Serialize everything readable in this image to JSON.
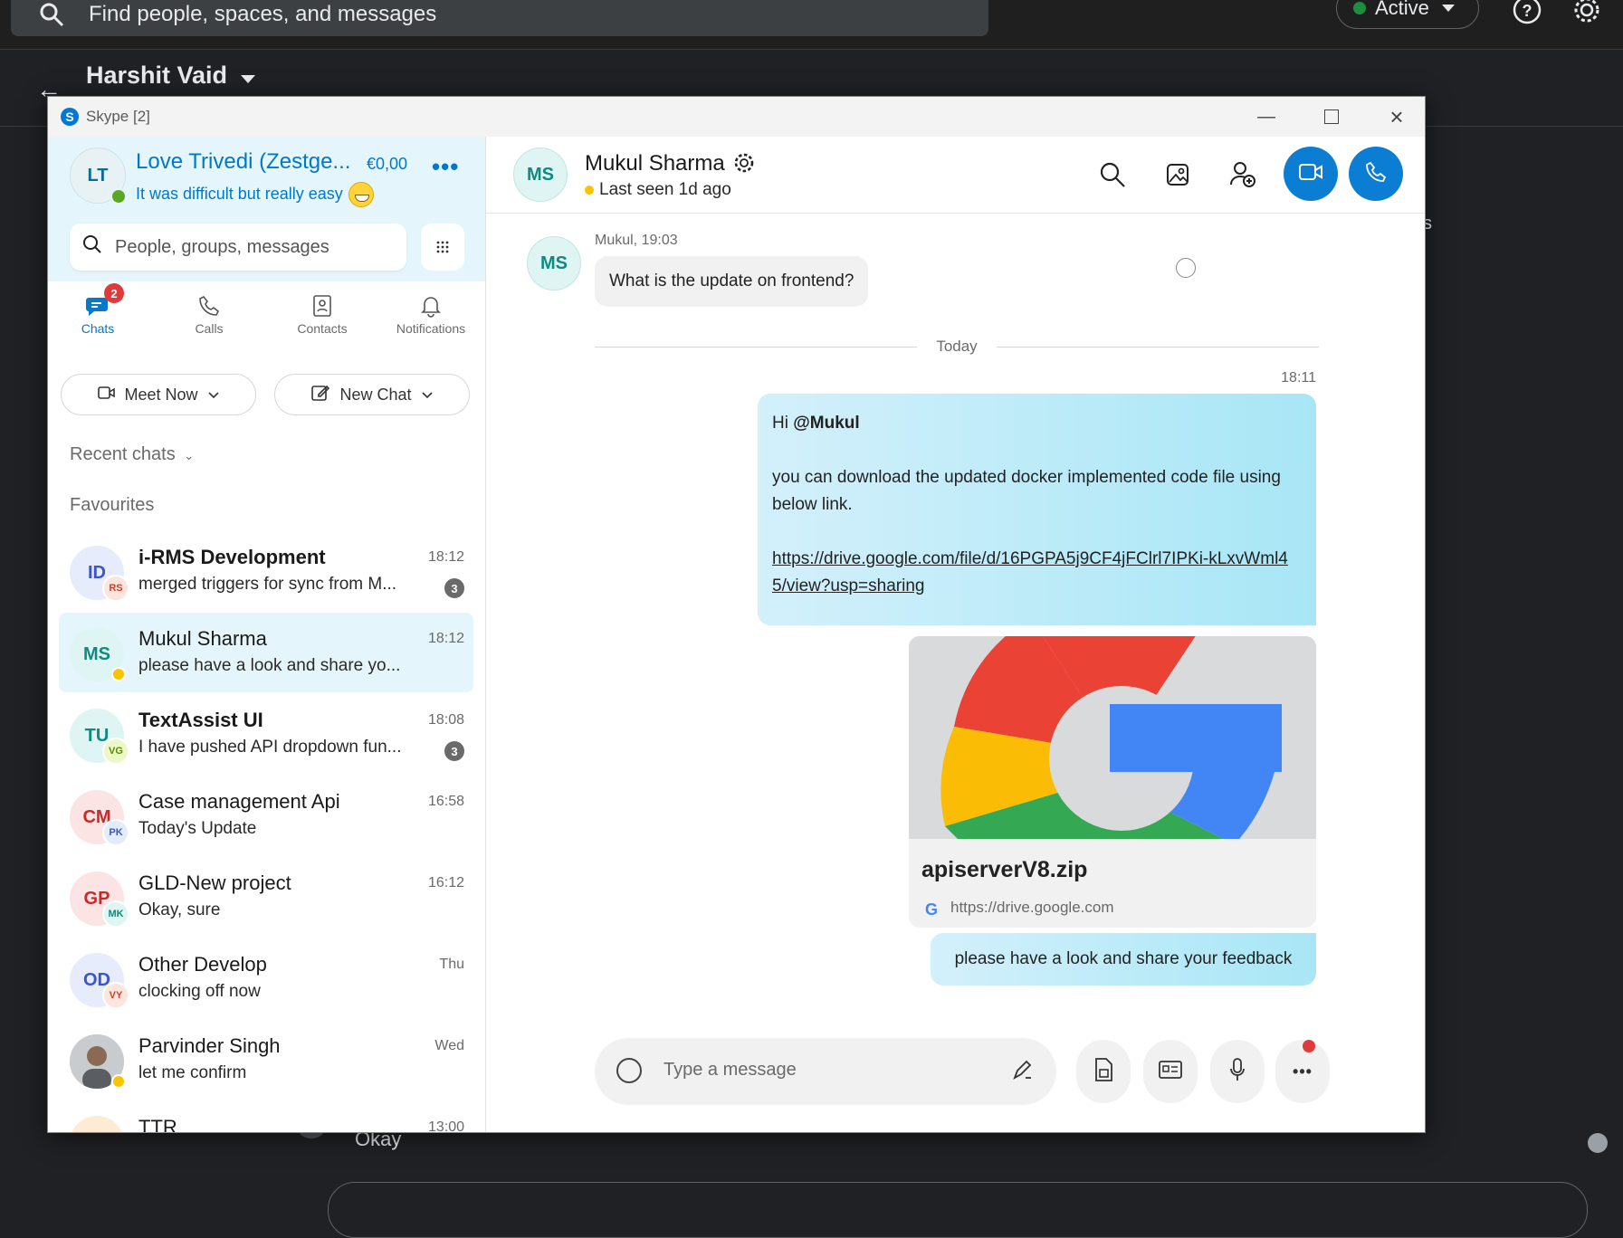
{
  "background_app": {
    "search_placeholder": "Find people, spaces, and messages",
    "status_label": "Active",
    "conversation_title": "Harshit Vaid",
    "last_message": "Okay",
    "partial_text": "s"
  },
  "window": {
    "title": "Skype [2]"
  },
  "profile": {
    "initials": "LT",
    "name": "Love Trivedi (Zestge...",
    "credit": "€0,00",
    "mood": "It was difficult but really easy",
    "search_placeholder": "People, groups, messages"
  },
  "tabs": [
    {
      "label": "Chats",
      "badge": "2",
      "active": true
    },
    {
      "label": "Calls"
    },
    {
      "label": "Contacts"
    },
    {
      "label": "Notifications"
    }
  ],
  "actions": {
    "meet_now": "Meet Now",
    "new_chat": "New Chat"
  },
  "sections": {
    "recent": "Recent chats",
    "favourites": "Favourites"
  },
  "chats": [
    {
      "initials": "ID",
      "sub": "RS",
      "name": "i-RMS Development",
      "message": "merged triggers for sync from M...",
      "time": "18:12",
      "unread": "3",
      "bold": true
    },
    {
      "initials": "MS",
      "name": "Mukul Sharma",
      "message": "please have a look and share yo...",
      "time": "18:12",
      "selected": true
    },
    {
      "initials": "TU",
      "sub": "VG",
      "name": "TextAssist UI",
      "message": "I have pushed API dropdown fun...",
      "time": "18:08",
      "unread": "3",
      "bold": true
    },
    {
      "initials": "CM",
      "sub": "PK",
      "name": "Case management Api",
      "message": "Today's Update",
      "time": "16:58"
    },
    {
      "initials": "GP",
      "sub": "MK",
      "name": "GLD-New project",
      "message": "Okay, sure",
      "time": "16:12"
    },
    {
      "initials": "OD",
      "sub": "VY",
      "name": "Other Develop",
      "message": "clocking off now",
      "time": "Thu"
    },
    {
      "name": "Parvinder Singh",
      "message": "let me confirm",
      "time": "Wed"
    },
    {
      "name": "TTR",
      "message": "",
      "time": "13:00"
    }
  ],
  "conversation": {
    "initials": "MS",
    "name": "Mukul Sharma",
    "status": "Last seen 1d ago",
    "incoming": {
      "meta": "Mukul, 19:03",
      "text": "What is the update on frontend?"
    },
    "divider": "Today",
    "outgoing_time": "18:11",
    "outgoing": {
      "greeting": "Hi ",
      "mention": "@Mukul",
      "body": "you can download the updated docker implemented code file using below link.",
      "link": "https://drive.google.com/file/d/16PGPA5j9CF4jFClrl7IPKi-kLxvWml45/view?usp=sharing"
    },
    "attachment": {
      "file_name": "apiserverV8.zip",
      "source": "https://drive.google.com"
    },
    "followup": "please have a look and share your feedback",
    "compose_placeholder": "Type a message"
  },
  "colors": {
    "skype_blue": "#0078c8",
    "call_button": "#0b7ed3",
    "selected_chat": "#e4f6fb",
    "outgoing_bubble": "#a8e6f6",
    "unread_badge": "#e03a3a"
  }
}
